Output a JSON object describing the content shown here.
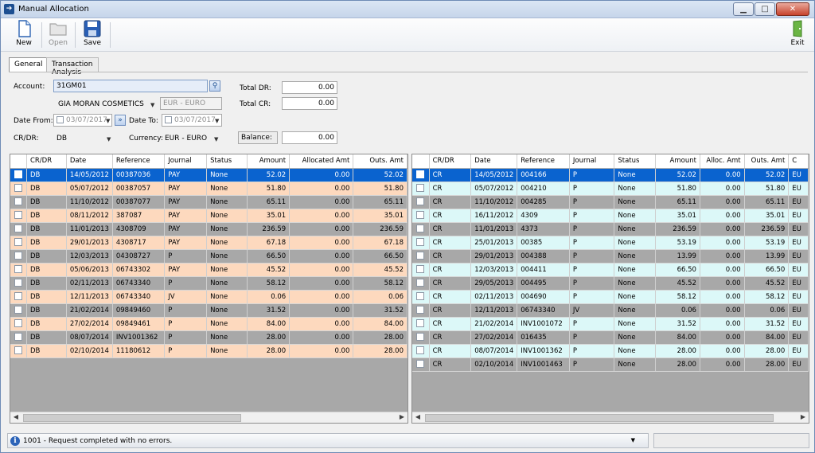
{
  "window": {
    "title": "Manual Allocation"
  },
  "toolbar": {
    "new_label": "New",
    "open_label": "Open",
    "save_label": "Save",
    "exit_label": "Exit"
  },
  "tabs": [
    {
      "label": "General",
      "active": true
    },
    {
      "label": "Transaction Analysis",
      "active": false
    }
  ],
  "form": {
    "account_label": "Account:",
    "account_value": "31GM01",
    "account_name": "GIA MORAN COSMETICS",
    "account_currency": "EUR - EURO",
    "date_from_label": "Date From:",
    "date_from_value": "03/07/2017",
    "date_to_label": "Date To:",
    "date_to_value": "03/07/2017",
    "crdr_label": "CR/DR:",
    "crdr_value": "DB",
    "currency_label": "Currency:",
    "currency_value": "EUR - EURO",
    "total_dr_label": "Total DR:",
    "total_dr_value": "0.00",
    "total_cr_label": "Total CR:",
    "total_cr_value": "0.00",
    "balance_label": "Balance:",
    "balance_value": "0.00"
  },
  "left_grid": {
    "columns": [
      "CR/DR",
      "Date",
      "Reference",
      "Journal",
      "Status",
      "Amount",
      "Allocated Amt",
      "Outs. Amt"
    ],
    "row_colors": {
      "alt": "#fdd9be",
      "selected": "#0a63cf"
    },
    "rows": [
      [
        "DB",
        "14/05/2012",
        "00387036",
        "PAY",
        "None",
        "52.02",
        "0.00",
        "52.02"
      ],
      [
        "DB",
        "05/07/2012",
        "00387057",
        "PAY",
        "None",
        "51.80",
        "0.00",
        "51.80"
      ],
      [
        "DB",
        "11/10/2012",
        "00387077",
        "PAY",
        "None",
        "65.11",
        "0.00",
        "65.11"
      ],
      [
        "DB",
        "08/11/2012",
        "387087",
        "PAY",
        "None",
        "35.01",
        "0.00",
        "35.01"
      ],
      [
        "DB",
        "11/01/2013",
        "4308709",
        "PAY",
        "None",
        "236.59",
        "0.00",
        "236.59"
      ],
      [
        "DB",
        "29/01/2013",
        "4308717",
        "PAY",
        "None",
        "67.18",
        "0.00",
        "67.18"
      ],
      [
        "DB",
        "12/03/2013",
        "04308727",
        "P",
        "None",
        "66.50",
        "0.00",
        "66.50"
      ],
      [
        "DB",
        "05/06/2013",
        "06743302",
        "PAY",
        "None",
        "45.52",
        "0.00",
        "45.52"
      ],
      [
        "DB",
        "02/11/2013",
        "06743340",
        "P",
        "None",
        "58.12",
        "0.00",
        "58.12"
      ],
      [
        "DB",
        "12/11/2013",
        "06743340",
        "JV",
        "None",
        "0.06",
        "0.00",
        "0.06"
      ],
      [
        "DB",
        "21/02/2014",
        "09849460",
        "P",
        "None",
        "31.52",
        "0.00",
        "31.52"
      ],
      [
        "DB",
        "27/02/2014",
        "09849461",
        "P",
        "None",
        "84.00",
        "0.00",
        "84.00"
      ],
      [
        "DB",
        "08/07/2014",
        "INV1001362",
        "P",
        "None",
        "28.00",
        "0.00",
        "28.00"
      ],
      [
        "DB",
        "02/10/2014",
        "11180612",
        "P",
        "None",
        "28.00",
        "0.00",
        "28.00"
      ]
    ]
  },
  "right_grid": {
    "columns": [
      "CR/DR",
      "Date",
      "Reference",
      "Journal",
      "Status",
      "Amount",
      "Alloc. Amt",
      "Outs. Amt",
      "C"
    ],
    "row_colors": {
      "alt": "#dcf8f8",
      "selected": "#0a63cf"
    },
    "rows": [
      [
        "CR",
        "14/05/2012",
        "004166",
        "P",
        "None",
        "52.02",
        "0.00",
        "52.02",
        "EU"
      ],
      [
        "CR",
        "05/07/2012",
        "004210",
        "P",
        "None",
        "51.80",
        "0.00",
        "51.80",
        "EU"
      ],
      [
        "CR",
        "11/10/2012",
        "004285",
        "P",
        "None",
        "65.11",
        "0.00",
        "65.11",
        "EU"
      ],
      [
        "CR",
        "16/11/2012",
        "4309",
        "P",
        "None",
        "35.01",
        "0.00",
        "35.01",
        "EU"
      ],
      [
        "CR",
        "11/01/2013",
        "4373",
        "P",
        "None",
        "236.59",
        "0.00",
        "236.59",
        "EU"
      ],
      [
        "CR",
        "25/01/2013",
        "00385",
        "P",
        "None",
        "53.19",
        "0.00",
        "53.19",
        "EU"
      ],
      [
        "CR",
        "29/01/2013",
        "004388",
        "P",
        "None",
        "13.99",
        "0.00",
        "13.99",
        "EU"
      ],
      [
        "CR",
        "12/03/2013",
        "004411",
        "P",
        "None",
        "66.50",
        "0.00",
        "66.50",
        "EU"
      ],
      [
        "CR",
        "29/05/2013",
        "004495",
        "P",
        "None",
        "45.52",
        "0.00",
        "45.52",
        "EU"
      ],
      [
        "CR",
        "02/11/2013",
        "004690",
        "P",
        "None",
        "58.12",
        "0.00",
        "58.12",
        "EU"
      ],
      [
        "CR",
        "12/11/2013",
        "06743340",
        "JV",
        "None",
        "0.06",
        "0.00",
        "0.06",
        "EU"
      ],
      [
        "CR",
        "21/02/2014",
        "INV1001072",
        "P",
        "None",
        "31.52",
        "0.00",
        "31.52",
        "EU"
      ],
      [
        "CR",
        "27/02/2014",
        "016435",
        "P",
        "None",
        "84.00",
        "0.00",
        "84.00",
        "EU"
      ],
      [
        "CR",
        "08/07/2014",
        "INV1001362",
        "P",
        "None",
        "28.00",
        "0.00",
        "28.00",
        "EU"
      ],
      [
        "CR",
        "02/10/2014",
        "INV1001463",
        "P",
        "None",
        "28.00",
        "0.00",
        "28.00",
        "EU"
      ]
    ]
  },
  "status": {
    "message": "1001 -  Request completed with no errors."
  },
  "icons": {
    "app": "arrow-right-icon",
    "new": "new-document-icon",
    "open": "folder-icon",
    "save": "floppy-disk-icon",
    "exit": "exit-door-icon",
    "search": "search-icon",
    "info": "info-icon"
  }
}
